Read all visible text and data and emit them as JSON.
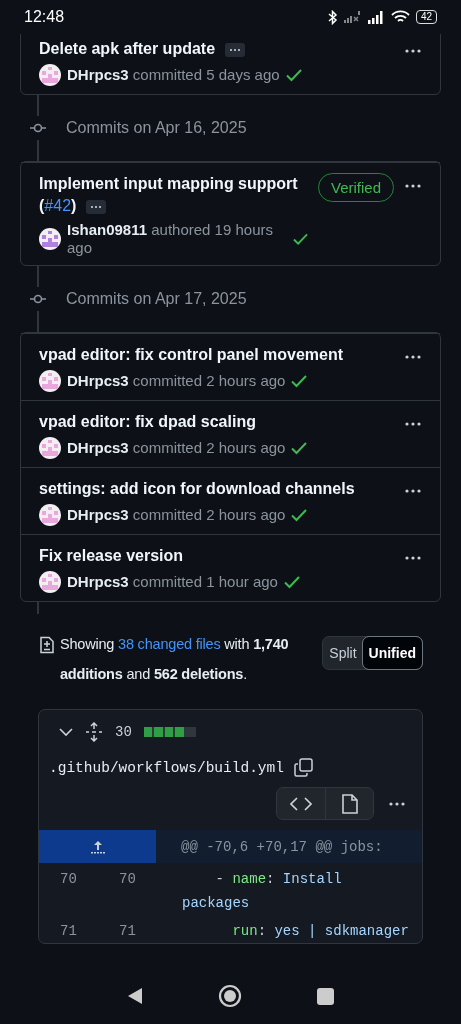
{
  "status_bar": {
    "time": "12:48",
    "battery": "42"
  },
  "timeline": [
    {
      "kind": "commits",
      "commits": [
        {
          "title": "Delete apk after update",
          "expandable": true,
          "author": "DHrpcs3",
          "action": "committed 5 days ago",
          "checks_passed": true,
          "color": "#e9a8dc"
        }
      ]
    },
    {
      "kind": "date",
      "label": "Commits on Apr 16, 2025"
    },
    {
      "kind": "commits",
      "commits": [
        {
          "title": "Implement input mapping support (",
          "link": "#42",
          "title_after": ")",
          "expandable": true,
          "badge": "Verified",
          "author": "Ishan09811",
          "action": "authored 19 hours ago",
          "checks_passed": true,
          "color": "#b080e0"
        }
      ]
    },
    {
      "kind": "date",
      "label": "Commits on Apr 17, 2025"
    },
    {
      "kind": "commits",
      "commits": [
        {
          "title": "vpad editor: fix control panel movement",
          "expandable": false,
          "author": "DHrpcs3",
          "action": "committed 2 hours ago",
          "checks_passed": true,
          "color": "#e9a8dc"
        },
        {
          "title": "vpad editor: fix dpad scaling",
          "expandable": false,
          "author": "DHrpcs3",
          "action": "committed 2 hours ago",
          "checks_passed": true,
          "color": "#e9a8dc"
        },
        {
          "title": "settings: add icon for download channels",
          "expandable": false,
          "author": "DHrpcs3",
          "action": "committed 2 hours ago",
          "checks_passed": true,
          "color": "#e9a8dc"
        },
        {
          "title": "Fix release version",
          "expandable": false,
          "author": "DHrpcs3",
          "action": "committed 1 hour ago",
          "checks_passed": true,
          "color": "#e9a8dc"
        }
      ]
    }
  ],
  "diff_summary": {
    "before": "Showing ",
    "link": "38 changed files",
    "after": " with **1,740 additions** and **562 deletions**."
  },
  "view_modes": [
    {
      "label": "Split",
      "selected": false
    },
    {
      "label": "Unified",
      "selected": true
    }
  ],
  "file": {
    "expanded": true,
    "changes": "30",
    "level": 0.8,
    "path": ".github/workflows/build.yml",
    "hunk": "@@ -70,6 +70,17 @@ jobs:",
    "lines": [
      {
        "old": "70",
        "new": "70",
        "tokens": [
          {
            "kind": "punct",
            "text": "    - "
          },
          {
            "kind": "key",
            "text": "name"
          },
          {
            "kind": "punct",
            "text": ": "
          },
          {
            "kind": "string",
            "text": "Install packages"
          }
        ]
      },
      {
        "old": "71",
        "new": "71",
        "tokens": [
          {
            "kind": "key",
            "text": "      run"
          },
          {
            "kind": "punct",
            "text": ": "
          },
          {
            "kind": "string",
            "text": "yes | sdkmanager"
          }
        ]
      }
    ]
  }
}
